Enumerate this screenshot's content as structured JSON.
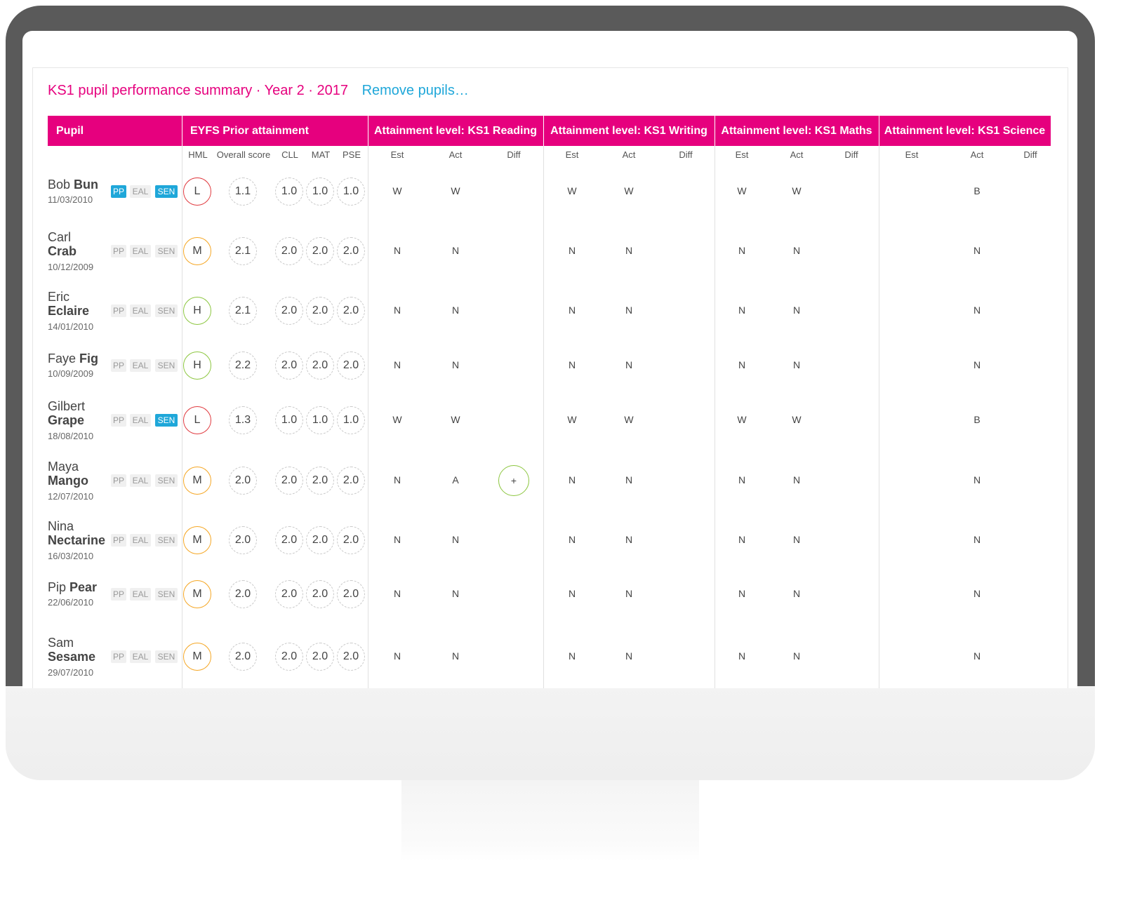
{
  "title": "KS1 pupil performance summary · Year 2 · 2017",
  "remove_link": "Remove pupils…",
  "headers": {
    "pupil": "Pupil",
    "eyfs": "EYFS Prior attainment",
    "reading": "Attainment level: KS1 Reading",
    "writing": "Attainment level: KS1 Writing",
    "maths": "Attainment level: KS1 Maths",
    "science": "Attainment level: KS1 Science"
  },
  "subheaders": {
    "hml": "HML",
    "overall": "Overall score",
    "cll": "CLL",
    "mat": "MAT",
    "pse": "PSE",
    "est": "Est",
    "act": "Act",
    "diff": "Diff"
  },
  "tag_labels": {
    "pp": "PP",
    "eal": "EAL",
    "sen": "SEN"
  },
  "colors": {
    "brand": "#e6007e",
    "link": "#1fa7d9",
    "low": "#e0393e",
    "medium": "#f5a623",
    "high": "#8cc63f"
  },
  "pupils": [
    {
      "first": "Bob",
      "last": "Bun",
      "dob": "11/03/2010",
      "pp": true,
      "eal": false,
      "sen": true,
      "hml": "L",
      "overall": "1.1",
      "cll": "1.0",
      "mat": "1.0",
      "pse": "1.0",
      "reading": {
        "est": "W",
        "act": "W",
        "diff": ""
      },
      "writing": {
        "est": "W",
        "act": "W",
        "diff": ""
      },
      "maths": {
        "est": "W",
        "act": "W",
        "diff": ""
      },
      "science": {
        "est": "",
        "act": "B",
        "diff": ""
      }
    },
    {
      "first": "Carl",
      "last": "Crab",
      "dob": "10/12/2009",
      "pp": false,
      "eal": false,
      "sen": false,
      "hml": "M",
      "overall": "2.1",
      "cll": "2.0",
      "mat": "2.0",
      "pse": "2.0",
      "reading": {
        "est": "N",
        "act": "N",
        "diff": ""
      },
      "writing": {
        "est": "N",
        "act": "N",
        "diff": ""
      },
      "maths": {
        "est": "N",
        "act": "N",
        "diff": ""
      },
      "science": {
        "est": "",
        "act": "N",
        "diff": ""
      }
    },
    {
      "first": "Eric",
      "last": "Eclaire",
      "dob": "14/01/2010",
      "pp": false,
      "eal": false,
      "sen": false,
      "hml": "H",
      "overall": "2.1",
      "cll": "2.0",
      "mat": "2.0",
      "pse": "2.0",
      "reading": {
        "est": "N",
        "act": "N",
        "diff": ""
      },
      "writing": {
        "est": "N",
        "act": "N",
        "diff": ""
      },
      "maths": {
        "est": "N",
        "act": "N",
        "diff": ""
      },
      "science": {
        "est": "",
        "act": "N",
        "diff": ""
      }
    },
    {
      "first": "Faye",
      "last": "Fig",
      "dob": "10/09/2009",
      "pp": false,
      "eal": false,
      "sen": false,
      "hml": "H",
      "overall": "2.2",
      "cll": "2.0",
      "mat": "2.0",
      "pse": "2.0",
      "reading": {
        "est": "N",
        "act": "N",
        "diff": ""
      },
      "writing": {
        "est": "N",
        "act": "N",
        "diff": ""
      },
      "maths": {
        "est": "N",
        "act": "N",
        "diff": ""
      },
      "science": {
        "est": "",
        "act": "N",
        "diff": ""
      }
    },
    {
      "first": "Gilbert",
      "last": "Grape",
      "dob": "18/08/2010",
      "pp": false,
      "eal": false,
      "sen": true,
      "hml": "L",
      "overall": "1.3",
      "cll": "1.0",
      "mat": "1.0",
      "pse": "1.0",
      "reading": {
        "est": "W",
        "act": "W",
        "diff": ""
      },
      "writing": {
        "est": "W",
        "act": "W",
        "diff": ""
      },
      "maths": {
        "est": "W",
        "act": "W",
        "diff": ""
      },
      "science": {
        "est": "",
        "act": "B",
        "diff": ""
      }
    },
    {
      "first": "Maya",
      "last": "Mango",
      "dob": "12/07/2010",
      "pp": false,
      "eal": false,
      "sen": false,
      "hml": "M",
      "overall": "2.0",
      "cll": "2.0",
      "mat": "2.0",
      "pse": "2.0",
      "reading": {
        "est": "N",
        "act": "A",
        "diff": "+"
      },
      "writing": {
        "est": "N",
        "act": "N",
        "diff": ""
      },
      "maths": {
        "est": "N",
        "act": "N",
        "diff": ""
      },
      "science": {
        "est": "",
        "act": "N",
        "diff": ""
      }
    },
    {
      "first": "Nina",
      "last": "Nectarine",
      "dob": "16/03/2010",
      "pp": false,
      "eal": false,
      "sen": false,
      "hml": "M",
      "overall": "2.0",
      "cll": "2.0",
      "mat": "2.0",
      "pse": "2.0",
      "reading": {
        "est": "N",
        "act": "N",
        "diff": ""
      },
      "writing": {
        "est": "N",
        "act": "N",
        "diff": ""
      },
      "maths": {
        "est": "N",
        "act": "N",
        "diff": ""
      },
      "science": {
        "est": "",
        "act": "N",
        "diff": ""
      }
    },
    {
      "first": "Pip",
      "last": "Pear",
      "dob": "22/06/2010",
      "pp": false,
      "eal": false,
      "sen": false,
      "hml": "M",
      "overall": "2.0",
      "cll": "2.0",
      "mat": "2.0",
      "pse": "2.0",
      "reading": {
        "est": "N",
        "act": "N",
        "diff": ""
      },
      "writing": {
        "est": "N",
        "act": "N",
        "diff": ""
      },
      "maths": {
        "est": "N",
        "act": "N",
        "diff": ""
      },
      "science": {
        "est": "",
        "act": "N",
        "diff": ""
      }
    },
    {
      "first": "Sam",
      "last": "Sesame",
      "dob": "29/07/2010",
      "pp": false,
      "eal": false,
      "sen": false,
      "hml": "M",
      "overall": "2.0",
      "cll": "2.0",
      "mat": "2.0",
      "pse": "2.0",
      "reading": {
        "est": "N",
        "act": "N",
        "diff": ""
      },
      "writing": {
        "est": "N",
        "act": "N",
        "diff": ""
      },
      "maths": {
        "est": "N",
        "act": "N",
        "diff": ""
      },
      "science": {
        "est": "",
        "act": "N",
        "diff": ""
      }
    }
  ]
}
